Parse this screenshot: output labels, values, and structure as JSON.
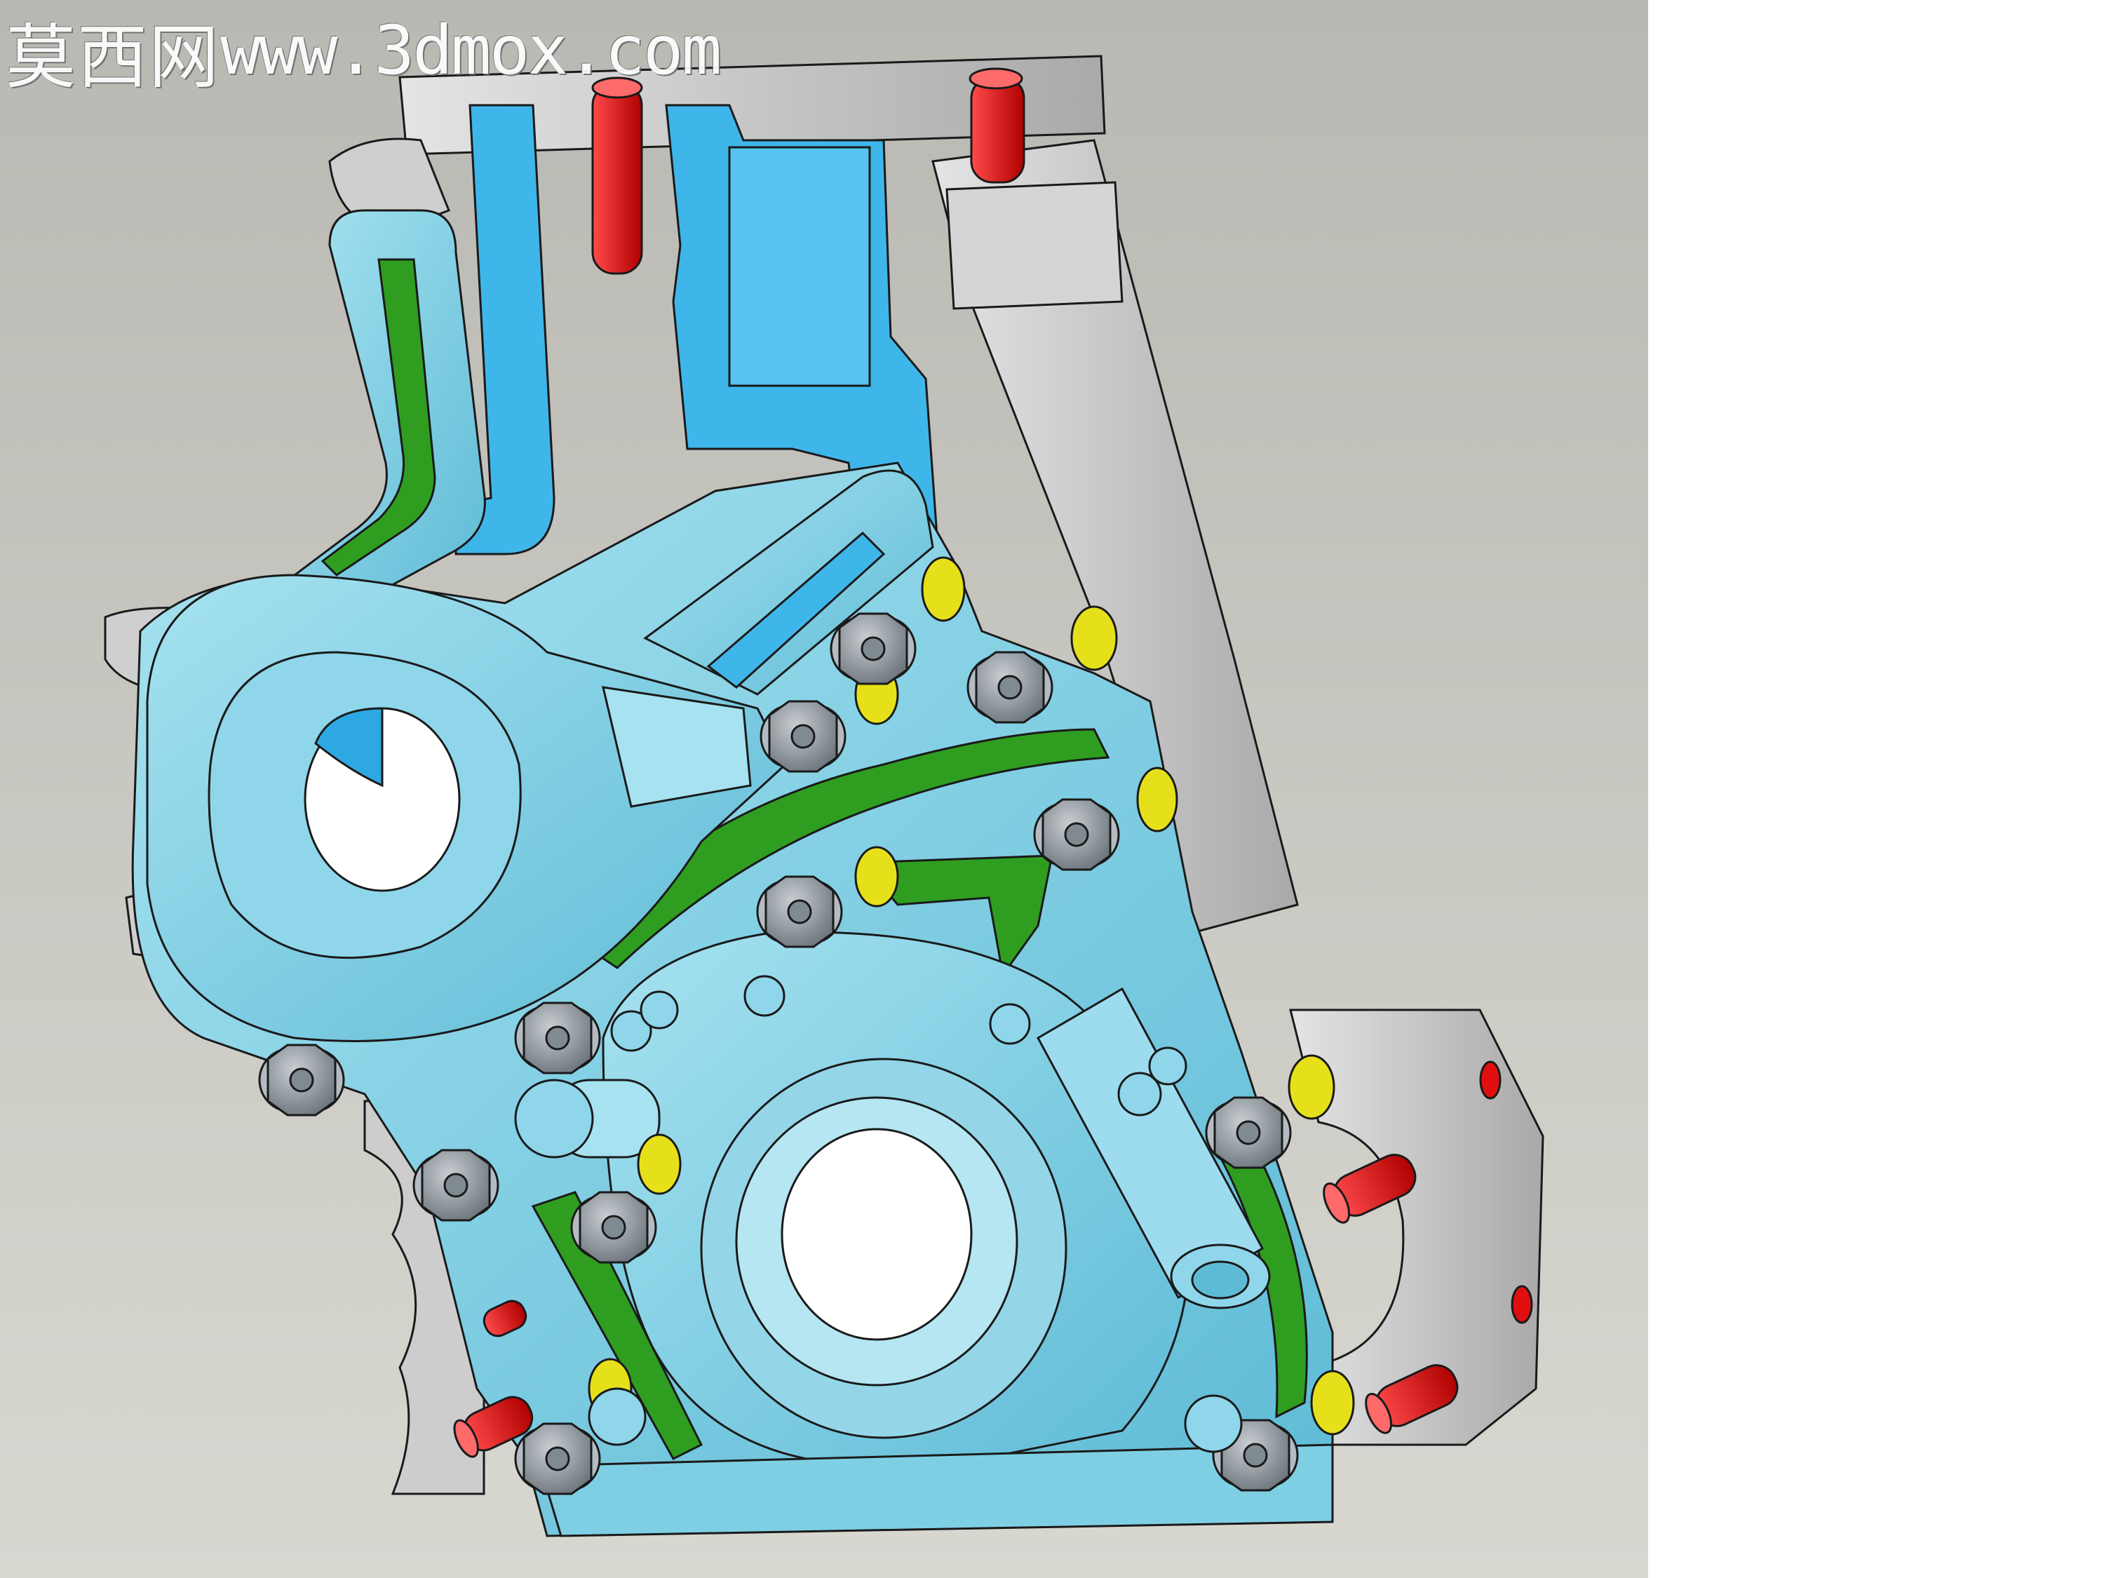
{
  "watermark": {
    "site_name": "莫西网",
    "url": "www.3dmox.com"
  },
  "colors": {
    "background_top": "#b9b8b2",
    "background_bottom": "#d8d7d0",
    "housing_gray": "#c7c7c7",
    "cover_cyan": "#7fcfe4",
    "water_blue": "#3fb6ea",
    "oil_green": "#2f9e20",
    "dowel_red": "#e00e0e",
    "sleeve_yellow": "#e6e01a",
    "bolt_gray": "#8c959c",
    "outline": "#1a1a1a"
  },
  "icons": [
    "engine-front-cover-render",
    "hex-bolt-icon",
    "dowel-pin-icon"
  ]
}
